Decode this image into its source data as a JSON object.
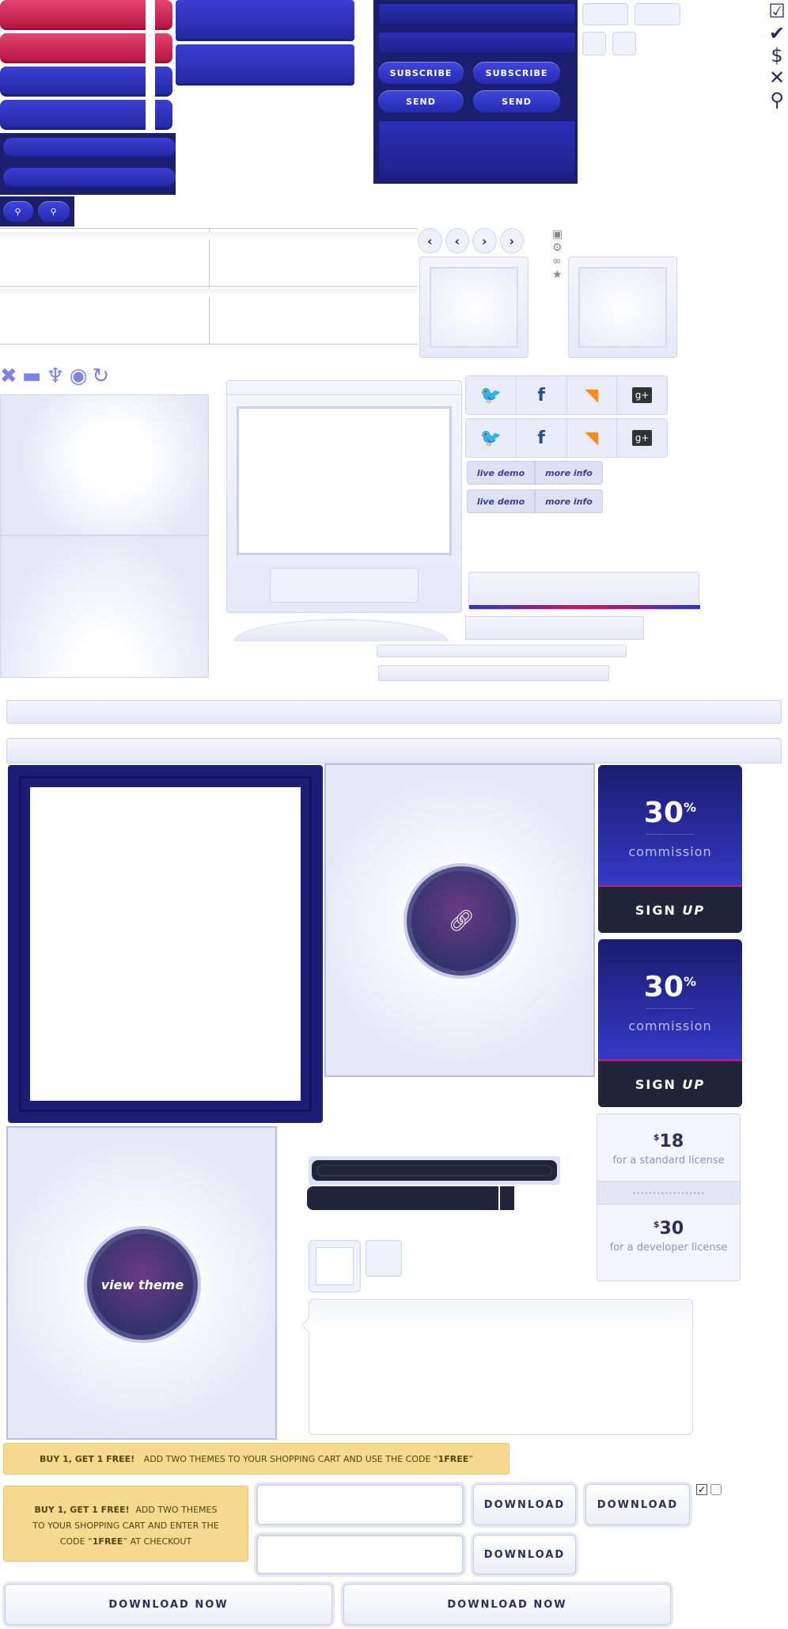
{
  "buttons": {
    "subscribe_label": "SUBSCRIBE",
    "send_label": "SEND"
  },
  "social": {
    "icons": [
      "twitter-icon",
      "facebook-icon",
      "rss-icon",
      "google-plus-icon"
    ],
    "glyphs": [
      "🐦",
      "f",
      "◥",
      "g+"
    ]
  },
  "tabs": {
    "live_demo": "live demo",
    "more_info": "more info"
  },
  "commission": {
    "percent": "30",
    "suffix": "%",
    "label": "commission",
    "signup_left": "SIGN",
    "signup_right": "UP"
  },
  "pricing": {
    "standard": {
      "currency": "$",
      "amount": "18",
      "label": "for a standard license"
    },
    "developer": {
      "currency": "$",
      "amount": "30",
      "label": "for a developer license"
    }
  },
  "view_theme": "view theme",
  "promo": {
    "strong": "BUY 1, GET 1 FREE!",
    "line": "ADD TWO THEMES TO YOUR SHOPPING CART AND USE THE CODE “",
    "code": "1FREE",
    "end": "”",
    "box_line1": "ADD TWO THEMES",
    "box_line2": "TO YOUR SHOPPING CART AND ENTER THE",
    "box_line3_prefix": "CODE “",
    "box_line3_suffix": "” AT CHECKOUT"
  },
  "download": {
    "label": "DOWNLOAD",
    "now_label": "DOWNLOAD NOW"
  },
  "colors": {
    "accent_red": "#c21d5a",
    "navy": "#1c1f6e",
    "blue": "#2e34c0",
    "pale": "#eef0fb"
  }
}
